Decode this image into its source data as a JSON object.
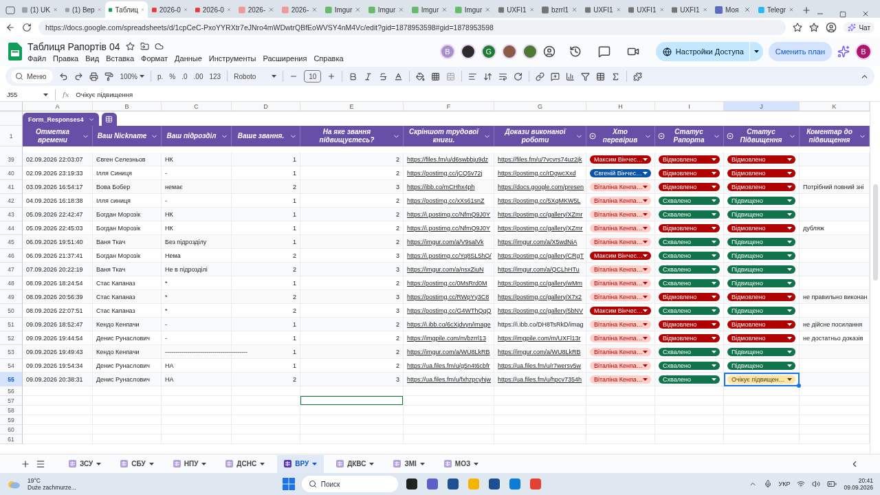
{
  "browser": {
    "tabs": [
      {
        "title": "(1) UK",
        "selected": false,
        "color": "#9aa0a6"
      },
      {
        "title": "(1) Вер",
        "selected": false,
        "color": "#9aa0a6"
      },
      {
        "title": "Таблиц",
        "selected": true,
        "color": "#0f9d58"
      },
      {
        "title": "2026-0",
        "selected": false,
        "color": "#e53935"
      },
      {
        "title": "2026-0",
        "selected": false,
        "color": "#e53935"
      },
      {
        "title": "2026-",
        "selected": false,
        "color": "#ef9a9a"
      },
      {
        "title": "2026-",
        "selected": false,
        "color": "#ef9a9a"
      },
      {
        "title": "Imgur",
        "selected": false,
        "color": "#66bb6a"
      },
      {
        "title": "Imgur",
        "selected": false,
        "color": "#66bb6a"
      },
      {
        "title": "Imgur",
        "selected": false,
        "color": "#66bb6a"
      },
      {
        "title": "Imgur",
        "selected": false,
        "color": "#66bb6a"
      },
      {
        "title": "UXFI1",
        "selected": false,
        "color": "#757575"
      },
      {
        "title": "bzrrl1",
        "selected": false,
        "color": "#757575"
      },
      {
        "title": "UXFI1",
        "selected": false,
        "color": "#757575"
      },
      {
        "title": "UXFI1",
        "selected": false,
        "color": "#757575"
      },
      {
        "title": "UXFI1",
        "selected": false,
        "color": "#757575"
      },
      {
        "title": "Моя",
        "selected": false,
        "color": "#5c6bc0"
      },
      {
        "title": "Telegr",
        "selected": false,
        "color": "#29b6f6"
      }
    ],
    "url": "https://docs.google.com/spreadsheets/d/1cpCeC-PxoYYRXtr7eJNro4mWDwtrQBfEoWVSY4nM4Vc/edit?gid=1878953598#gid=1878953598",
    "chat_label": "Чат"
  },
  "doc": {
    "title": "Таблиця Рапортів 04",
    "menu": [
      "Файл",
      "Правка",
      "Вид",
      "Вставка",
      "Формат",
      "Данные",
      "Инструменты",
      "Расширения",
      "Справка"
    ],
    "collaborators": [
      {
        "kind": "letter",
        "initial": "B",
        "color": "#a990c9"
      },
      {
        "kind": "picture",
        "color": "#2b2b2b"
      },
      {
        "kind": "letter",
        "initial": "G",
        "color": "#1e7b34"
      },
      {
        "kind": "picture",
        "color": "#8a5a4a"
      },
      {
        "kind": "picture",
        "color": "#4c7a34"
      }
    ],
    "share_label": "Настройки Доступа",
    "upgrade_label": "Сменить план",
    "account_initial": "B"
  },
  "toolbar": {
    "menu_search": "Меню",
    "zoom": "100%",
    "currency": "р.",
    "percent": "%",
    "dec_minus": ".0",
    "dec_plus": ".00",
    "number_format": "123",
    "font": "Roboto",
    "font_size": "10"
  },
  "formula_bar": {
    "cell": "J55",
    "fx": "fx",
    "value": "Очікує підвищення"
  },
  "columns": [
    {
      "letter": "A",
      "selected": false
    },
    {
      "letter": "B",
      "selected": false
    },
    {
      "letter": "C",
      "selected": false
    },
    {
      "letter": "D",
      "selected": false
    },
    {
      "letter": "E",
      "selected": false
    },
    {
      "letter": "F",
      "selected": false
    },
    {
      "letter": "G",
      "selected": false
    },
    {
      "letter": "H",
      "selected": false
    },
    {
      "letter": "I",
      "selected": false
    },
    {
      "letter": "J",
      "selected": true
    },
    {
      "letter": "K",
      "selected": false
    }
  ],
  "table_name": "Form_Responses4",
  "header_row": {
    "num": "1",
    "headers": [
      {
        "label": "Отметка времени",
        "chip_column": false
      },
      {
        "label": "Ваш Nickname",
        "chip_column": false
      },
      {
        "label": "Ваш підрозділ",
        "chip_column": false
      },
      {
        "label": "Ваше звання.",
        "chip_column": false
      },
      {
        "label": "На яке звання підвищуєтесь?",
        "chip_column": false
      },
      {
        "label": "Скріншот трудової книги.",
        "chip_column": false
      },
      {
        "label": "Докази виконаної роботи",
        "chip_column": false
      },
      {
        "label": "Хто перевірив",
        "chip_column": true
      },
      {
        "label": "Статус Рапорта",
        "chip_column": true
      },
      {
        "label": "Статус Підвищення",
        "chip_column": true
      },
      {
        "label": "Коментар до підвищення",
        "chip_column": false
      }
    ]
  },
  "rows": [
    {
      "num": "39",
      "selected": false,
      "cells": [
        "02.09.2026 22:03:07",
        "Євген Селезньов",
        "НК",
        "1",
        "2"
      ],
      "screenshot": "https://files.fm/u/d6swbbju9dz",
      "proof": {
        "text": "https://files.fm/u/7vcvrs74uz2jk",
        "link": true
      },
      "reviewer": {
        "text": "Максим Вінчес…",
        "color": "#b10202"
      },
      "status": {
        "text": "Відмовлено",
        "color": "#b10202"
      },
      "promotion": {
        "text": "Відмовлено",
        "color": "#b10202"
      }
    },
    {
      "num": "40",
      "selected": false,
      "cells": [
        "02.09.2026 23:19:33",
        "Ілля Синиця",
        "-",
        "1",
        "2"
      ],
      "screenshot": "https://postimg.cc/jCQ5v72j",
      "proof": {
        "text": "https://postimg.cc/rDgwcXxd",
        "link": true
      },
      "reviewer": {
        "text": "Євгеній Вінчес…",
        "color": "#0a53a8"
      },
      "status": {
        "text": "Відмовлено",
        "color": "#b10202"
      },
      "promotion": {
        "text": "Відмовлено",
        "color": "#b10202"
      }
    },
    {
      "num": "41",
      "selected": false,
      "cells": [
        "03.09.2026 16:54:17",
        "Вова Бобер",
        "немає",
        "2",
        "3"
      ],
      "screenshot": "https://ibb.co/mCHhx4ph",
      "proof": {
        "text": "https://docs.google.com/presen",
        "link": true
      },
      "reviewer": {
        "text": "Віталіна Кенпа…",
        "color": "#ffcfc9"
      },
      "status": {
        "text": "Відмовлено",
        "color": "#b10202"
      },
      "promotion": {
        "text": "Відмовлено",
        "color": "#b10202"
      },
      "comment": "Потрібний повний зні"
    },
    {
      "num": "42",
      "selected": false,
      "cells": [
        "04.09.2026 16:18:38",
        "Ілля синиця",
        "-",
        "1",
        "2"
      ],
      "screenshot": "https://postimg.cc/xXs61snZ",
      "proof": {
        "text": "https://postimg.cc/5XqMKW5L",
        "link": true
      },
      "reviewer": {
        "text": "Віталіна Кенпа…",
        "color": "#ffcfc9"
      },
      "status": {
        "text": "Схвалено",
        "color": "#11734b"
      },
      "promotion": {
        "text": "Підвищено",
        "color": "#11734b"
      }
    },
    {
      "num": "43",
      "selected": false,
      "cells": [
        "05.09.2026 22:42:47",
        "Богдан Морозік",
        "НК",
        "1",
        "2"
      ],
      "screenshot": "https://i.postimg.cc/NfmQ9J0Y",
      "proof": {
        "text": "https://postimg.cc/gallery/XZmr",
        "link": true
      },
      "reviewer": {
        "text": "Віталіна Кенпа…",
        "color": "#ffcfc9"
      },
      "status": {
        "text": "Схвалено",
        "color": "#11734b"
      },
      "promotion": {
        "text": "Підвищено",
        "color": "#11734b"
      }
    },
    {
      "num": "44",
      "selected": false,
      "cells": [
        "05.09.2026 22:45:03",
        "Богдан Морозік",
        "НК",
        "1",
        "2"
      ],
      "screenshot": "https://i.postimg.cc/NfmQ9J0Y",
      "proof": {
        "text": "https://postimg.cc/gallery/XZmr",
        "link": true
      },
      "reviewer": {
        "text": "Віталіна Кенпа…",
        "color": "#ffcfc9"
      },
      "status": {
        "text": "Відмовлено",
        "color": "#b10202"
      },
      "promotion": {
        "text": "Відмовлено",
        "color": "#b10202"
      },
      "comment": "дубляж"
    },
    {
      "num": "45",
      "selected": false,
      "cells": [
        "06.09.2026 19:51:40",
        "Ваня Ткач",
        "Без підрозділу",
        "1",
        "2"
      ],
      "screenshot": "https://imgur.com/a/V9salVk",
      "proof": {
        "text": "https://imgur.com/a/X5wdNiA",
        "link": true
      },
      "reviewer": {
        "text": "Віталіна Кенпа…",
        "color": "#ffcfc9"
      },
      "status": {
        "text": "Схвалено",
        "color": "#11734b"
      },
      "promotion": {
        "text": "Підвищено",
        "color": "#11734b"
      }
    },
    {
      "num": "46",
      "selected": false,
      "cells": [
        "06.09.2026 21:37:41",
        "Богдан Морозік",
        "Нема",
        "2",
        "3"
      ],
      "screenshot": "https://i.postimg.cc/Yq8SL5hQ/",
      "proof": {
        "text": "https://postimg.cc/gallery/CRgT",
        "link": true
      },
      "reviewer": {
        "text": "Максим Вінчес…",
        "color": "#b10202"
      },
      "status": {
        "text": "Схвалено",
        "color": "#11734b"
      },
      "promotion": {
        "text": "Підвищено",
        "color": "#11734b"
      }
    },
    {
      "num": "47",
      "selected": false,
      "cells": [
        "07.09.2026 20:22:19",
        "Ваня Ткач",
        "Не в підрозділі",
        "2",
        "3"
      ],
      "screenshot": "https://imgur.com/a/nsxZiuN",
      "proof": {
        "text": "https://imgur.com/a/QCLhHTu",
        "link": true
      },
      "reviewer": {
        "text": "Віталіна Кенпа…",
        "color": "#ffcfc9"
      },
      "status": {
        "text": "Схвалено",
        "color": "#11734b"
      },
      "promotion": {
        "text": "Підвищено",
        "color": "#11734b"
      }
    },
    {
      "num": "48",
      "selected": false,
      "cells": [
        "08.09.2026 18:24:54",
        "Стас Капаназ",
        "*",
        "1",
        "2"
      ],
      "screenshot": "https://postimg.cc/0MsRrd0M",
      "proof": {
        "text": "https://postimg.cc/gallery/wMm",
        "link": true
      },
      "reviewer": {
        "text": "Віталіна Кенпа…",
        "color": "#ffcfc9"
      },
      "status": {
        "text": "Схвалено",
        "color": "#11734b"
      },
      "promotion": {
        "text": "Підвищено",
        "color": "#11734b"
      }
    },
    {
      "num": "49",
      "selected": false,
      "cells": [
        "08.09.2026 20:56:39",
        "Стас Капаназ",
        "*",
        "2",
        "3"
      ],
      "screenshot": "https://postimg.cc/RWpYy3C8",
      "proof": {
        "text": "https://postimg.cc/gallery/X7x2",
        "link": true
      },
      "reviewer": {
        "text": "Віталіна Кенпа…",
        "color": "#ffcfc9"
      },
      "status": {
        "text": "Відмовлено",
        "color": "#b10202"
      },
      "promotion": {
        "text": "Відмовлено",
        "color": "#b10202"
      },
      "comment": "не правильно виконан"
    },
    {
      "num": "50",
      "selected": false,
      "cells": [
        "08.09.2026 22:07:51",
        "Стас Капаназ",
        "*",
        "2",
        "3"
      ],
      "screenshot": "https://postimg.cc/G4WThQqQ",
      "proof": {
        "text": "https://postimg.cc/gallery/5bNV",
        "link": true
      },
      "reviewer": {
        "text": "Максим Вінчес…",
        "color": "#b10202"
      },
      "status": {
        "text": "Схвалено",
        "color": "#11734b"
      },
      "promotion": {
        "text": "Підвищено",
        "color": "#11734b"
      }
    },
    {
      "num": "51",
      "selected": false,
      "cells": [
        "09.09.2026 18:52:47",
        "Кендо Кенпачи",
        "-",
        "1",
        "2"
      ],
      "screenshot": "https://i.ibb.co/6cXjdvyn/image",
      "proof": {
        "text": "https://i.ibb.co/DH8TsRkD/imag",
        "link": false
      },
      "reviewer": {
        "text": "Віталіна Кенпа…",
        "color": "#ffcfc9"
      },
      "status": {
        "text": "Відмовлено",
        "color": "#b10202"
      },
      "promotion": {
        "text": "Відмовлено",
        "color": "#b10202"
      },
      "comment": "не дійсне посилання"
    },
    {
      "num": "52",
      "selected": false,
      "cells": [
        "09.09.2026 19:44:54",
        "Денис Рунаслович",
        "-",
        "1",
        "2"
      ],
      "screenshot": "https://imgpile.com/m/bzrrl13",
      "proof": {
        "text": "https://imgpile.com/m/UXFl13r",
        "link": true
      },
      "reviewer": {
        "text": "Віталіна Кенпа…",
        "color": "#ffcfc9"
      },
      "status": {
        "text": "Відмовлено",
        "color": "#b10202"
      },
      "promotion": {
        "text": "Відмовлено",
        "color": "#b10202"
      },
      "comment": "не достатньо доказів"
    },
    {
      "num": "53",
      "selected": false,
      "cells": [
        "09.09.2026 19:49:43",
        "Кендо Кенпачи",
        "----------------------------------------",
        "1",
        "2"
      ],
      "screenshot": "https://imgur.com/a/WU8LkRB",
      "proof": {
        "text": "https://imgur.com/a/WU8LkRB",
        "link": true
      },
      "reviewer": {
        "text": "Віталіна Кенпа…",
        "color": "#ffcfc9"
      },
      "status": {
        "text": "Схвалено",
        "color": "#11734b"
      },
      "promotion": {
        "text": "Підвищено",
        "color": "#11734b"
      }
    },
    {
      "num": "54",
      "selected": false,
      "cells": [
        "09.09.2026 19:54:34",
        "Денис Рунаслович",
        "НА",
        "1",
        "2"
      ],
      "screenshot": "https://ua.files.fm/u/g5n4t6cbfr",
      "proof": {
        "text": "https://ua.files.fm/u/r7wersv5w",
        "link": true
      },
      "reviewer": {
        "text": "Віталіна Кенпа…",
        "color": "#ffcfc9"
      },
      "status": {
        "text": "Схвалено",
        "color": "#11734b"
      },
      "promotion": {
        "text": "Підвищено",
        "color": "#11734b"
      }
    },
    {
      "num": "55",
      "selected": true,
      "cells": [
        "09.09.2026 20:38:31",
        "Денис Рунаслович",
        "НА",
        "2",
        "3"
      ],
      "screenshot": "https://ua.files.fm/u/fxhzpcyhjw",
      "proof": {
        "text": "https://ua.files.fm/u/hpcv7354h",
        "link": true
      },
      "reviewer": {
        "text": "Віталіна Кенпа…",
        "color": "#ffcfc9"
      },
      "status": {
        "text": "Схвалено",
        "color": "#11734b"
      },
      "promotion": {
        "text": "Очікує підвищен…",
        "color": "#ffe5a0"
      }
    }
  ],
  "empty_rows": [
    {
      "num": "56",
      "outlined": false
    },
    {
      "num": "57",
      "outlined": true
    },
    {
      "num": "58",
      "outlined": false
    },
    {
      "num": "59",
      "outlined": false
    },
    {
      "num": "60",
      "outlined": false
    },
    {
      "num": "61",
      "outlined": false
    }
  ],
  "sheets": [
    {
      "label": "ЗСУ",
      "selected": false
    },
    {
      "label": "СБУ",
      "selected": false
    },
    {
      "label": "НПУ",
      "selected": false
    },
    {
      "label": "ДСНС",
      "selected": false
    },
    {
      "label": "ВРУ",
      "selected": true
    },
    {
      "label": "ДКВС",
      "selected": false
    },
    {
      "label": "ЗМІ",
      "selected": false
    },
    {
      "label": "МОЗ",
      "selected": false
    }
  ],
  "taskbar": {
    "temperature": "19°C",
    "weather": "Duże zachmurze...",
    "search": "Поиск",
    "language": "УКР",
    "time": "20:41",
    "date": "09.09.2026"
  }
}
